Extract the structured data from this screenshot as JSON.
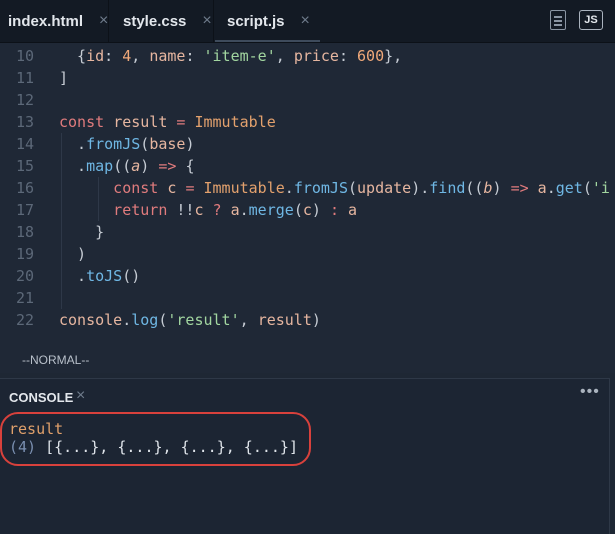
{
  "tabs": [
    {
      "label": "index.html",
      "close": "×"
    },
    {
      "label": "style.css",
      "close": "×"
    },
    {
      "label": "script.js",
      "close": "×"
    }
  ],
  "header": {
    "lang_badge": "JS"
  },
  "editor": {
    "lines": [
      {
        "n": "10",
        "tokens": [
          [
            "pun",
            "  {"
          ],
          [
            "var",
            "id"
          ],
          [
            "pun",
            ": "
          ],
          [
            "num",
            "4"
          ],
          [
            "pun",
            ", "
          ],
          [
            "var",
            "name"
          ],
          [
            "pun",
            ": "
          ],
          [
            "str",
            "'item-e'"
          ],
          [
            "pun",
            ", "
          ],
          [
            "var",
            "price"
          ],
          [
            "pun",
            ": "
          ],
          [
            "num",
            "600"
          ],
          [
            "pun",
            "},"
          ]
        ]
      },
      {
        "n": "11",
        "tokens": [
          [
            "pun",
            "]"
          ]
        ]
      },
      {
        "n": "12",
        "tokens": []
      },
      {
        "n": "13",
        "tokens": [
          [
            "kw",
            "const "
          ],
          [
            "var",
            "result "
          ],
          [
            "kw",
            "= "
          ],
          [
            "cls",
            "Immutable"
          ]
        ]
      },
      {
        "n": "14",
        "tokens": [
          [
            "pun",
            "  ."
          ],
          [
            "fn",
            "fromJS"
          ],
          [
            "pun",
            "("
          ],
          [
            "var",
            "base"
          ],
          [
            "pun",
            ")"
          ]
        ]
      },
      {
        "n": "15",
        "tokens": [
          [
            "pun",
            "  ."
          ],
          [
            "fn",
            "map"
          ],
          [
            "pun",
            "(("
          ],
          [
            "prm",
            "a"
          ],
          [
            "pun",
            ") "
          ],
          [
            "kw",
            "=> "
          ],
          [
            "pun",
            "{"
          ]
        ]
      },
      {
        "n": "16",
        "tokens": [
          [
            "kw",
            "      const "
          ],
          [
            "var",
            "c "
          ],
          [
            "kw",
            "= "
          ],
          [
            "cls",
            "Immutable"
          ],
          [
            "pun",
            "."
          ],
          [
            "fn",
            "fromJS"
          ],
          [
            "pun",
            "("
          ],
          [
            "var",
            "update"
          ],
          [
            "pun",
            ")."
          ],
          [
            "fn",
            "find"
          ],
          [
            "pun",
            "(("
          ],
          [
            "prm",
            "b"
          ],
          [
            "pun",
            ") "
          ],
          [
            "kw",
            "=> "
          ],
          [
            "var",
            "a"
          ],
          [
            "pun",
            "."
          ],
          [
            "fn",
            "get"
          ],
          [
            "pun",
            "("
          ],
          [
            "str",
            "'i"
          ]
        ]
      },
      {
        "n": "17",
        "tokens": [
          [
            "kw",
            "      return "
          ],
          [
            "pun",
            "!!"
          ],
          [
            "var",
            "c "
          ],
          [
            "kw",
            "? "
          ],
          [
            "var",
            "a"
          ],
          [
            "pun",
            "."
          ],
          [
            "fn",
            "merge"
          ],
          [
            "pun",
            "("
          ],
          [
            "var",
            "c"
          ],
          [
            "pun",
            ") "
          ],
          [
            "kw",
            ": "
          ],
          [
            "var",
            "a"
          ]
        ]
      },
      {
        "n": "18",
        "tokens": [
          [
            "pun",
            "    }"
          ]
        ]
      },
      {
        "n": "19",
        "tokens": [
          [
            "pun",
            "  )"
          ]
        ]
      },
      {
        "n": "20",
        "tokens": [
          [
            "pun",
            "  ."
          ],
          [
            "fn",
            "toJS"
          ],
          [
            "pun",
            "()"
          ]
        ]
      },
      {
        "n": "21",
        "tokens": []
      },
      {
        "n": "22",
        "tokens": [
          [
            "var",
            "console"
          ],
          [
            "pun",
            "."
          ],
          [
            "fn",
            "log"
          ],
          [
            "pun",
            "("
          ],
          [
            "str",
            "'result'"
          ],
          [
            "pun",
            ", "
          ],
          [
            "var",
            "result"
          ],
          [
            "pun",
            ")"
          ]
        ]
      }
    ]
  },
  "status": {
    "mode": "--NORMAL--"
  },
  "console": {
    "title": "CONSOLE",
    "close": "×",
    "more": "•••",
    "output_label": "result",
    "output_count": "(4)",
    "output_value": " [{...}, {...}, {...}, {...}]"
  },
  "colors": {
    "highlight": "#d8413c",
    "accent_tab": "#3e4b5c"
  }
}
